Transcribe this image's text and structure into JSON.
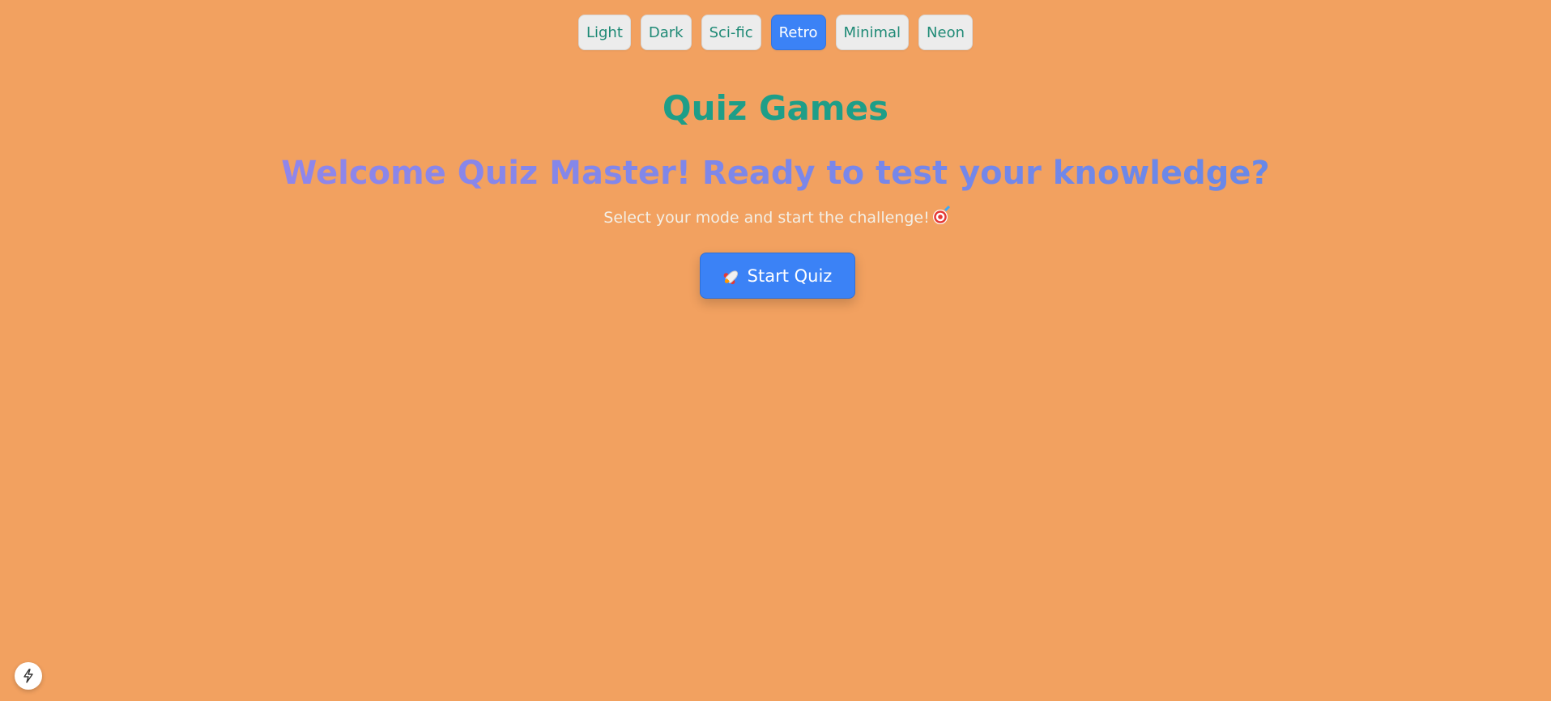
{
  "theme_bar": {
    "options": [
      {
        "label": "Light",
        "active": false
      },
      {
        "label": "Dark",
        "active": false
      },
      {
        "label": "Sci-fic",
        "active": false
      },
      {
        "label": "Retro",
        "active": true
      },
      {
        "label": "Minimal",
        "active": false
      },
      {
        "label": "Neon",
        "active": false
      }
    ]
  },
  "header": {
    "title": "Quiz Games"
  },
  "hero": {
    "welcome": "Welcome Quiz Master! Ready to test your knowledge?",
    "subtitle": "Select your mode and start the challenge!",
    "subtitle_icon": "target-icon"
  },
  "start_button": {
    "label": "Start Quiz",
    "icon": "rocket-icon"
  },
  "corner_button": {
    "icon": "lightning-icon"
  },
  "colors": {
    "background": "#f2a160",
    "accent": "#3b82f6",
    "title": "#1e9e88",
    "theme_text": "#1f8a76"
  }
}
